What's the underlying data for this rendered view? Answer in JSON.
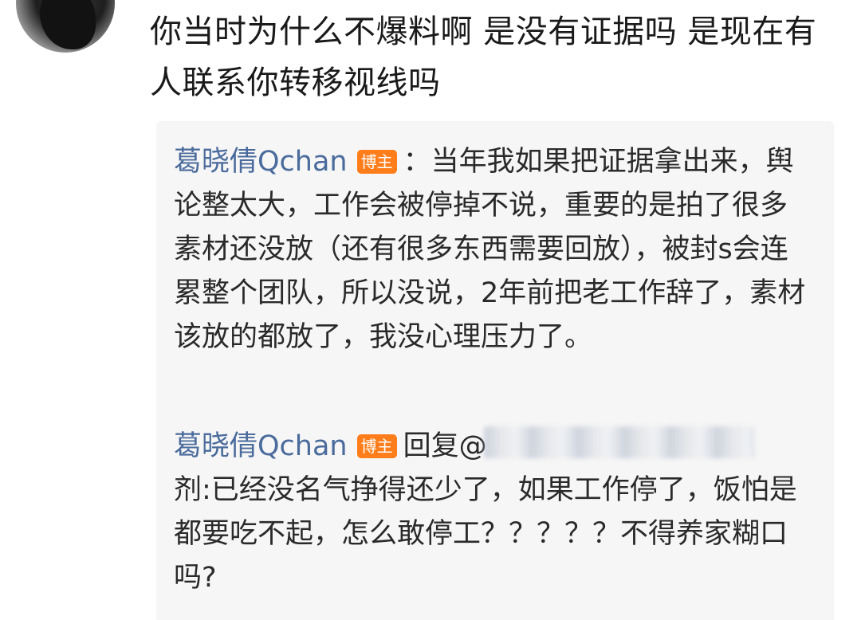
{
  "comment": {
    "text": "你当时为什么不爆料啊 是没有证据吗  是现在有人联系你转移视线吗"
  },
  "replies": [
    {
      "username": "葛晓倩Qchan",
      "badge": "博主",
      "separator": "：",
      "text": "当年我如果把证据拿出来，舆论整太大，工作会被停掉不说，重要的是拍了很多素材还没放（还有很多东西需要回放），被封s会连累整个团队，所以没说，2年前把老工作辞了，素材该放的都放了，我没心理压力了。"
    },
    {
      "username": "葛晓倩Qchan",
      "badge": "博主",
      "reply_prefix": "回复@",
      "reply_to_tail": "剂",
      "text": ":已经没名气挣得还少了，如果工作停了，饭怕是都要吃不起，怎么敢停工？？？？？不得养家糊口吗?"
    }
  ]
}
